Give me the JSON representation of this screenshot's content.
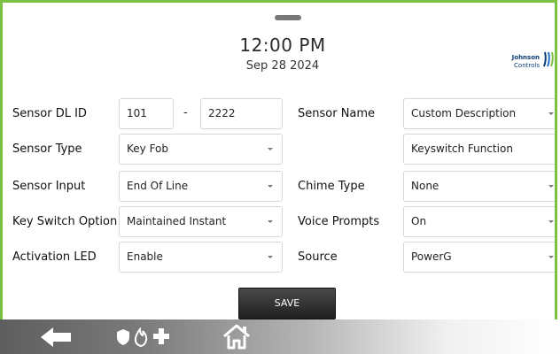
{
  "header": {
    "time": "12:00 PM",
    "date": "Sep 28 2024",
    "logo": {
      "line1": "Johnson",
      "line2": "Controls"
    }
  },
  "form": {
    "sensor_dl_id": {
      "label": "Sensor DL ID",
      "part1": "101",
      "separator": "-",
      "part2": "2222"
    },
    "sensor_name": {
      "label": "Sensor Name",
      "value": "Custom Description"
    },
    "sensor_type": {
      "label": "Sensor Type",
      "value": "Key Fob"
    },
    "custom_description": {
      "value": "Keyswitch Function"
    },
    "sensor_input": {
      "label": "Sensor Input",
      "value": "End Of Line"
    },
    "chime_type": {
      "label": "Chime Type",
      "value": "None"
    },
    "key_switch_option": {
      "label": "Key Switch Option",
      "value": "Maintained Instant"
    },
    "voice_prompts": {
      "label": "Voice Prompts",
      "value": "On"
    },
    "activation_led": {
      "label": "Activation LED",
      "value": "Enable"
    },
    "source": {
      "label": "Source",
      "value": "PowerG"
    }
  },
  "actions": {
    "save_label": "SAVE"
  },
  "colors": {
    "frame_border": "#7dc142",
    "save_button": "#2f2f2f",
    "logo_blue": "#0a3d78"
  },
  "nav_icons": [
    "back-arrow-icon",
    "shield-icon",
    "fire-icon",
    "medical-cross-icon",
    "home-icon"
  ]
}
